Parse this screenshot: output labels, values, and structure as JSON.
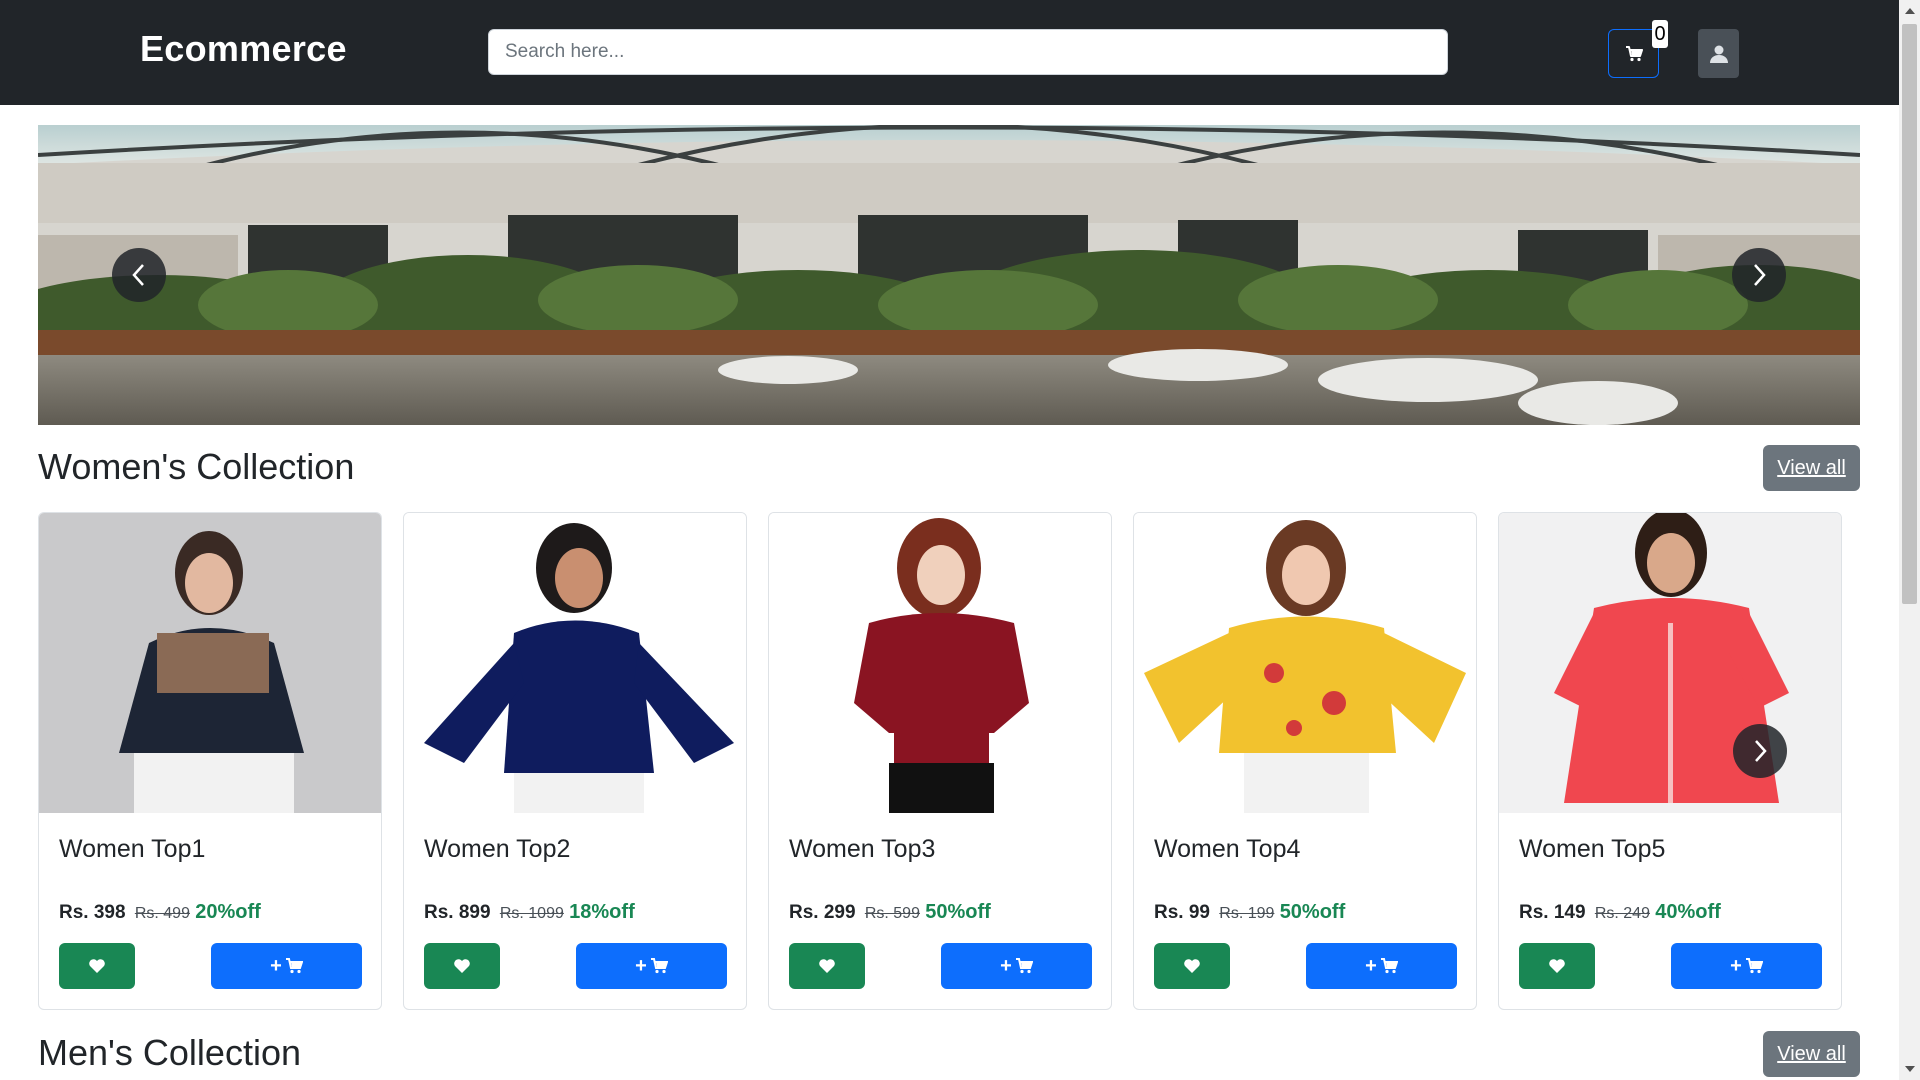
{
  "header": {
    "brand": "Ecommerce",
    "search_placeholder": "Search here...",
    "cart_count": "0",
    "cart_icon": "cart-icon",
    "user_icon": "user-icon"
  },
  "banner": {
    "prev_icon": "chevron-left-icon",
    "next_icon": "chevron-right-icon"
  },
  "sections": [
    {
      "title": "Women's Collection",
      "view_all": "View all",
      "products": [
        {
          "name": "Women Top1",
          "price": "Rs. 398",
          "mrp": "Rs. 499",
          "discount": "20%off",
          "color": "#1d2535"
        },
        {
          "name": "Women Top2",
          "price": "Rs. 899",
          "mrp": "Rs. 1099",
          "discount": "18%off",
          "color": "#0f1c5e"
        },
        {
          "name": "Women Top3",
          "price": "Rs. 299",
          "mrp": "Rs. 599",
          "discount": "50%off",
          "color": "#8a1422"
        },
        {
          "name": "Women Top4",
          "price": "Rs. 99",
          "mrp": "Rs. 199",
          "discount": "50%off",
          "color": "#f2c22e"
        },
        {
          "name": "Women Top5",
          "price": "Rs. 149",
          "mrp": "Rs. 249",
          "discount": "40%off",
          "color": "#f0474f"
        }
      ]
    },
    {
      "title": "Men's Collection",
      "view_all": "View all"
    }
  ],
  "card_buttons": {
    "wishlist_icon": "heart-icon",
    "add_to_cart_label": "+",
    "add_to_cart_icon": "cart-icon"
  },
  "colors": {
    "navbar": "#212529",
    "primary": "#0d6efd",
    "success": "#198754",
    "secondary": "#6c757d"
  }
}
